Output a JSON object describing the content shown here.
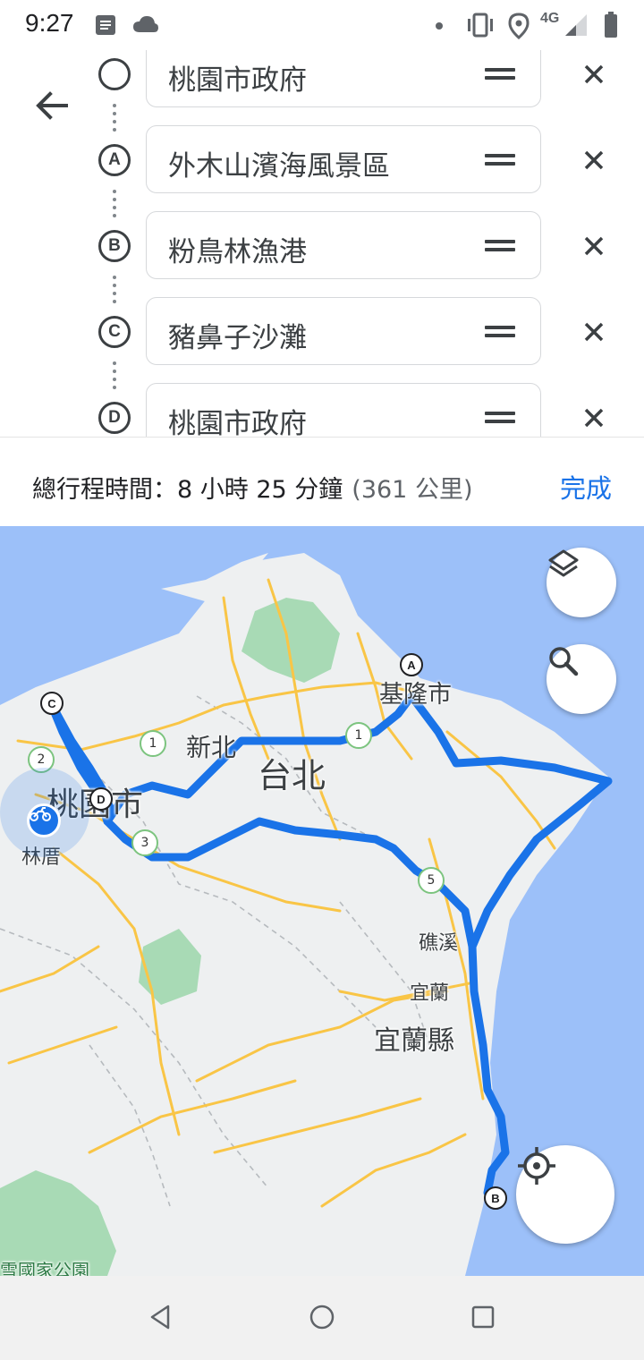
{
  "status_bar": {
    "time": "9:27",
    "network": "4G",
    "icons": [
      "message-icon",
      "cloud-icon",
      "dot-icon",
      "vibrate-icon",
      "location-icon",
      "signal-icon",
      "battery-icon"
    ]
  },
  "waypoints": [
    {
      "marker": "",
      "name": "桃園市政府"
    },
    {
      "marker": "A",
      "name": "外木山濱海風景區"
    },
    {
      "marker": "B",
      "name": "粉鳥林漁港"
    },
    {
      "marker": "C",
      "name": "豬鼻子沙灘"
    },
    {
      "marker": "D",
      "name": "桃園市政府"
    }
  ],
  "summary": {
    "time_text": "總行程時間：8 小時 25 分鐘",
    "distance_text": "(361 公里)",
    "done_label": "完成"
  },
  "map": {
    "labels": {
      "taipei": "台北",
      "new_taipei": "新北",
      "taoyuan_city": "桃園市",
      "keelung": "基隆市",
      "linkou": "林厝",
      "jiaoxi": "礁溪",
      "yilan": "宜蘭",
      "yilan_county": "宜蘭縣",
      "national_park": "雪國家公園"
    },
    "route_markers": {
      "a": "A",
      "b": "B",
      "c": "C",
      "d": "D"
    },
    "highway_shields": [
      "1",
      "1",
      "2",
      "3",
      "5"
    ],
    "colors": {
      "route": "#1a73e8",
      "sea": "#9cc0f9",
      "land": "#eef0f1",
      "park": "#a8dab5",
      "road": "#f9c546"
    }
  },
  "nav_bar": {
    "buttons": [
      "back-triangle-icon",
      "home-circle-icon",
      "recents-square-icon"
    ]
  }
}
